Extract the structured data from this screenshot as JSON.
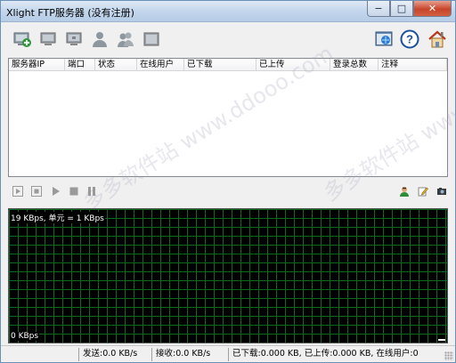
{
  "window": {
    "title": "Xlight FTP服务器 (没有注册)",
    "controls": {
      "minimize": "−",
      "maximize": "□",
      "close": "✕"
    }
  },
  "toolbar": {
    "left_icons": [
      "add-server-icon",
      "server-icon",
      "server-settings-icon",
      "user-icon",
      "users-icon",
      "log-icon"
    ],
    "right_icons": [
      "global-settings-icon",
      "help-icon",
      "home-icon"
    ],
    "help_glyph": "?"
  },
  "server_list": {
    "columns": [
      "服务器IP",
      "端口",
      "状态",
      "在线用户",
      "已下载",
      "已上传",
      "登录总数",
      "注释"
    ],
    "rows": [],
    "watermark": "多多软件站 www.ddooo.com"
  },
  "controls": {
    "left_icons": [
      "start-icon",
      "stop-icon",
      "play-icon",
      "stop-square-icon",
      "pause-icon"
    ],
    "right_icons": [
      "online-user-icon",
      "edit-icon",
      "camera-icon"
    ]
  },
  "graph": {
    "top_label": "19 KBps, 单元 = 1 KBps",
    "bottom_label": "0 KBps",
    "grid_color": "#0d6b1f",
    "background": "#000000"
  },
  "status_bar": {
    "send": "发送:0.0 KB/s",
    "receive": "接收:0.0 KB/s",
    "summary": "已下载:0.000 KB, 已上传:0.000 KB, 在线用户:0"
  }
}
